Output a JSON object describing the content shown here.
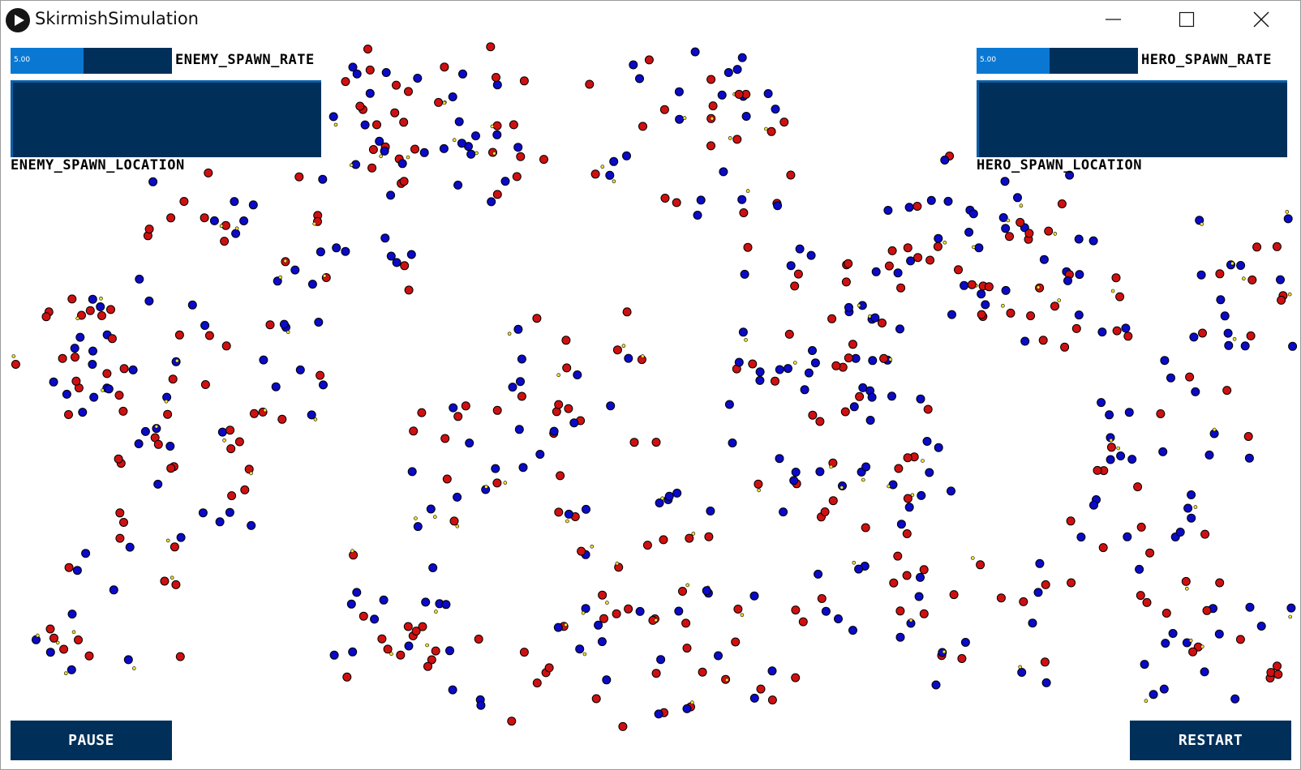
{
  "window": {
    "title": "SkirmishSimulation"
  },
  "controls": {
    "enemy_spawn_rate": {
      "label": "ENEMY_SPAWN_RATE",
      "value": "5.00",
      "fraction": 0.45
    },
    "hero_spawn_rate": {
      "label": "HERO_SPAWN_RATE",
      "value": "5.00",
      "fraction": 0.45
    },
    "enemy_spawn_location": {
      "label": "ENEMY_SPAWN_LOCATION"
    },
    "hero_spawn_location": {
      "label": "HERO_SPAWN_LOCATION"
    },
    "pause_label": "PAUSE",
    "restart_label": "RESTART"
  },
  "colors": {
    "enemy": "#d01010",
    "hero": "#0a0ac8",
    "projectile": "#f0e030",
    "control_dark": "#00305a",
    "control_fill": "#0a78d2"
  }
}
